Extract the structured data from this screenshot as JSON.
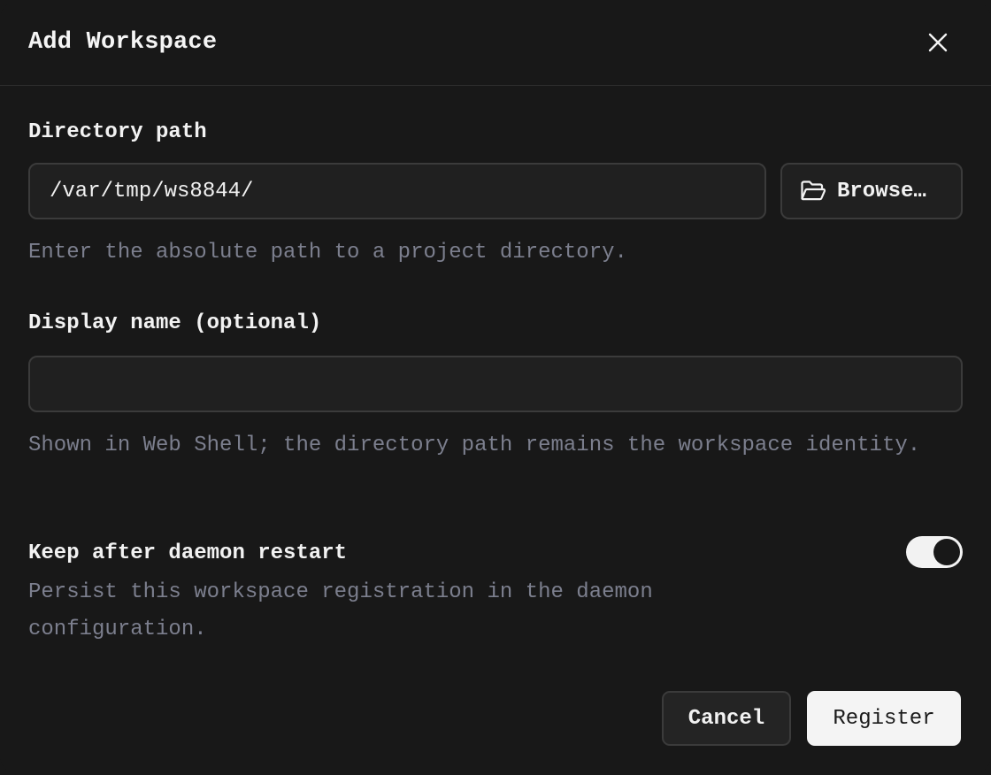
{
  "dialog": {
    "title": "Add Workspace",
    "close_icon": "close-icon"
  },
  "directory": {
    "label": "Directory path",
    "value": "/var/tmp/ws8844/",
    "browse_label": "Browse…",
    "browse_icon": "folder-open-icon",
    "hint": "Enter the absolute path to a project directory."
  },
  "display_name": {
    "label": "Display name (optional)",
    "value": "",
    "hint": "Shown in Web Shell; the directory path remains the workspace identity."
  },
  "persist": {
    "label": "Keep after daemon restart",
    "hint": "Persist this workspace registration in the daemon configuration.",
    "enabled": true
  },
  "actions": {
    "cancel_label": "Cancel",
    "register_label": "Register"
  },
  "colors": {
    "background": "#181818",
    "input_background": "#202020",
    "border": "#3b3b3b",
    "hint_text": "#7c7f8e",
    "primary_button": "#f4f4f4"
  }
}
